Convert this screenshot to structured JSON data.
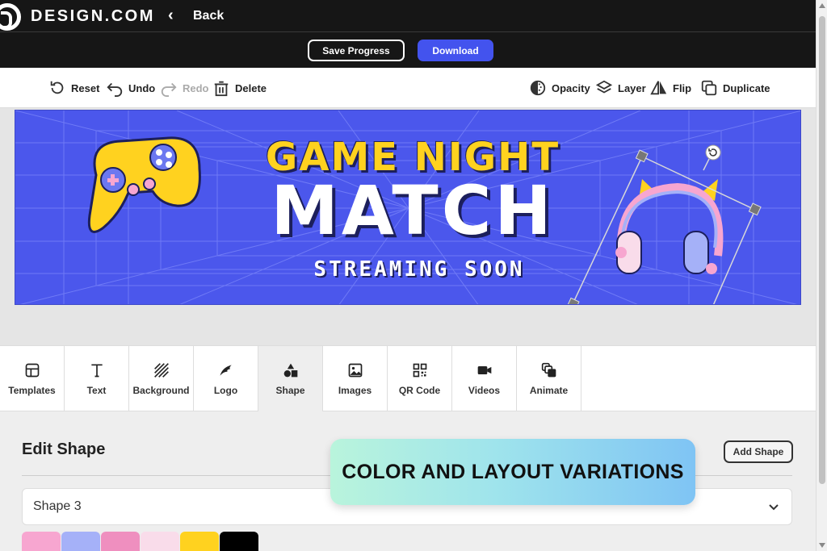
{
  "header": {
    "brand": "DESIGN.COM",
    "back_label": "Back",
    "save_label": "Save Progress",
    "download_label": "Download",
    "accent_color": "#4353ee"
  },
  "toolbar": {
    "reset": "Reset",
    "undo": "Undo",
    "redo": "Redo",
    "delete": "Delete",
    "opacity": "Opacity",
    "layer": "Layer",
    "flip": "Flip",
    "duplicate": "Duplicate"
  },
  "banner": {
    "line1": "GAME NIGHT",
    "line2": "MATCH",
    "line3": "STREAMING SOON",
    "background_color": "#4b57ec",
    "title_color": "#ffd21f"
  },
  "tabs": [
    {
      "label": "Templates",
      "icon": "templates-icon"
    },
    {
      "label": "Text",
      "icon": "text-icon"
    },
    {
      "label": "Background",
      "icon": "background-icon"
    },
    {
      "label": "Logo",
      "icon": "logo-icon"
    },
    {
      "label": "Shape",
      "icon": "shape-icon",
      "active": true
    },
    {
      "label": "Images",
      "icon": "images-icon"
    },
    {
      "label": "QR Code",
      "icon": "qr-code-icon"
    },
    {
      "label": "Videos",
      "icon": "videos-icon"
    },
    {
      "label": "Animate",
      "icon": "animate-icon"
    }
  ],
  "panel": {
    "title": "Edit Shape",
    "add_shape_label": "Add Shape",
    "selected_shape": "Shape 3",
    "swatches": [
      "#f7a6d0",
      "#a5b1f8",
      "#ef8fbf",
      "#f9dcea",
      "#ffd21f",
      "#000000"
    ]
  },
  "overlay": {
    "text": "COLOR AND LAYOUT VARIATIONS"
  }
}
